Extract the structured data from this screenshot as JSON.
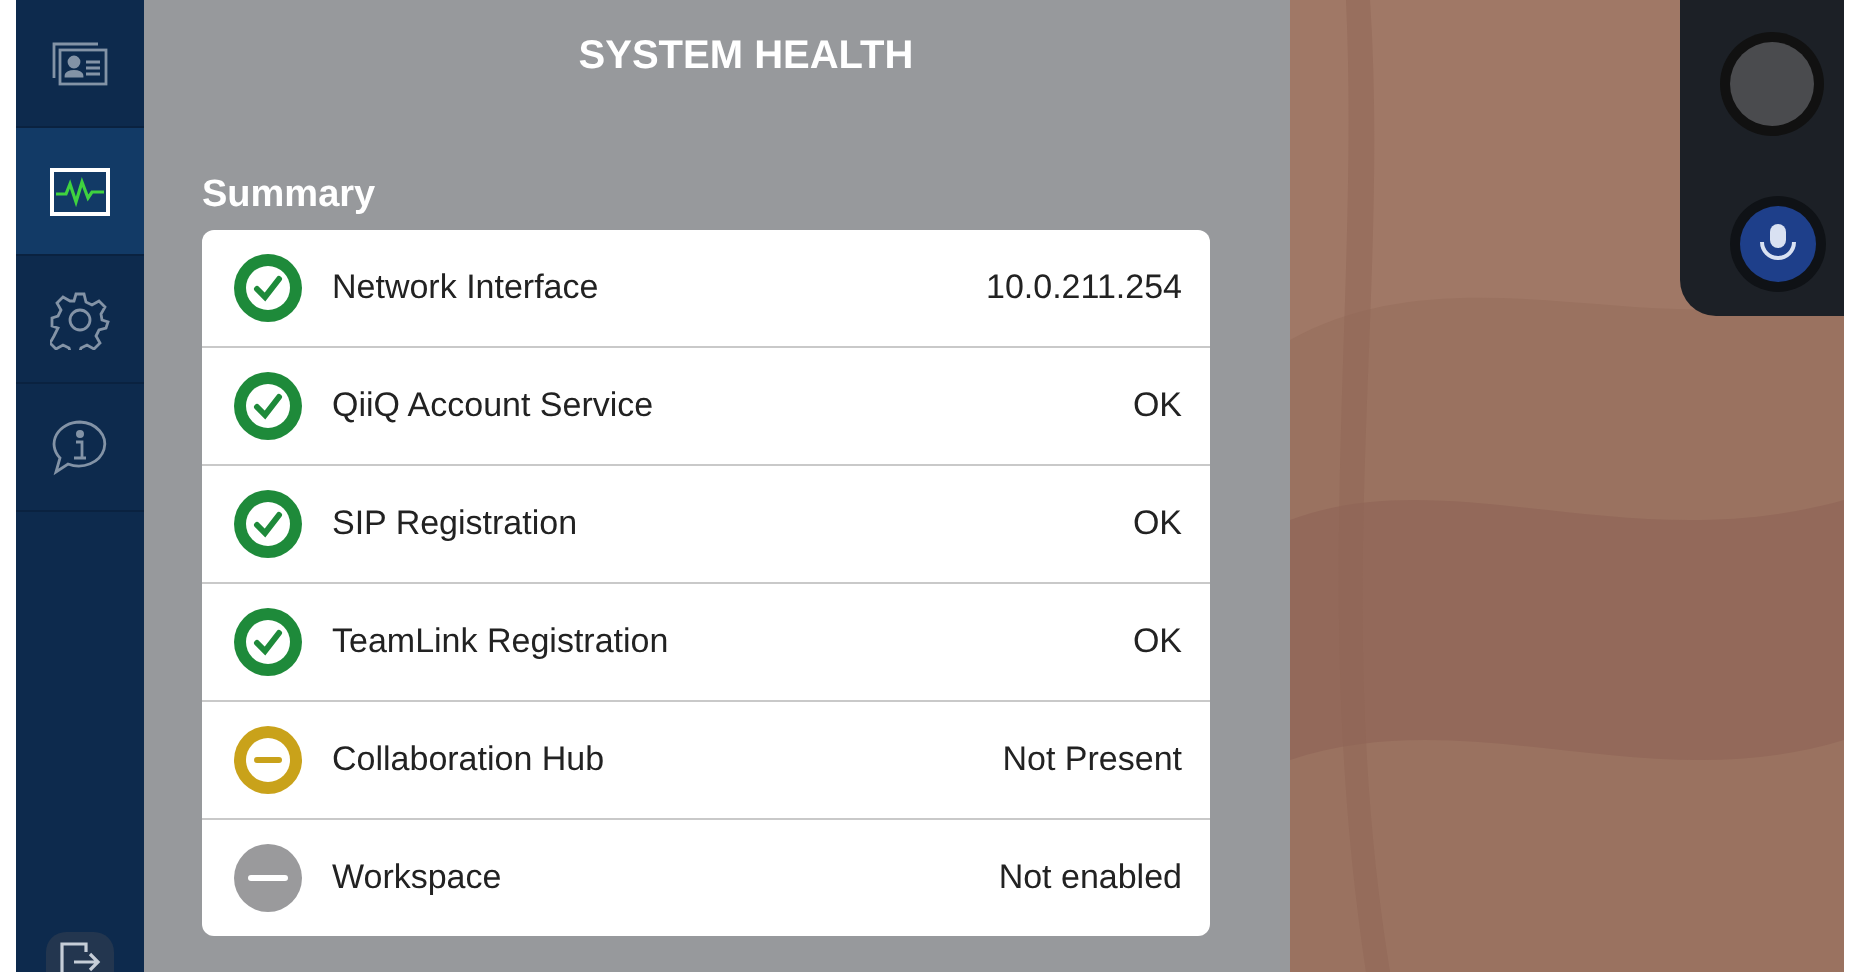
{
  "title": "SYSTEM HEALTH",
  "nav": [
    {
      "kind": "contact",
      "selected": false
    },
    {
      "kind": "health",
      "selected": true
    },
    {
      "kind": "settings",
      "selected": false
    },
    {
      "kind": "info",
      "selected": false
    }
  ],
  "section": "Summary",
  "rows": [
    {
      "label": "Network Interface",
      "value": "10.0.211.254",
      "kind": "ok"
    },
    {
      "label": "QiiQ Account Service",
      "value": "OK",
      "kind": "ok"
    },
    {
      "label": "SIP Registration",
      "value": "OK",
      "kind": "ok"
    },
    {
      "label": "TeamLink Registration",
      "value": "OK",
      "kind": "ok"
    },
    {
      "label": "Collaboration Hub",
      "value": "Not Present",
      "kind": "warning"
    },
    {
      "label": "Workspace",
      "value": "Not enabled",
      "kind": "disabled"
    }
  ]
}
